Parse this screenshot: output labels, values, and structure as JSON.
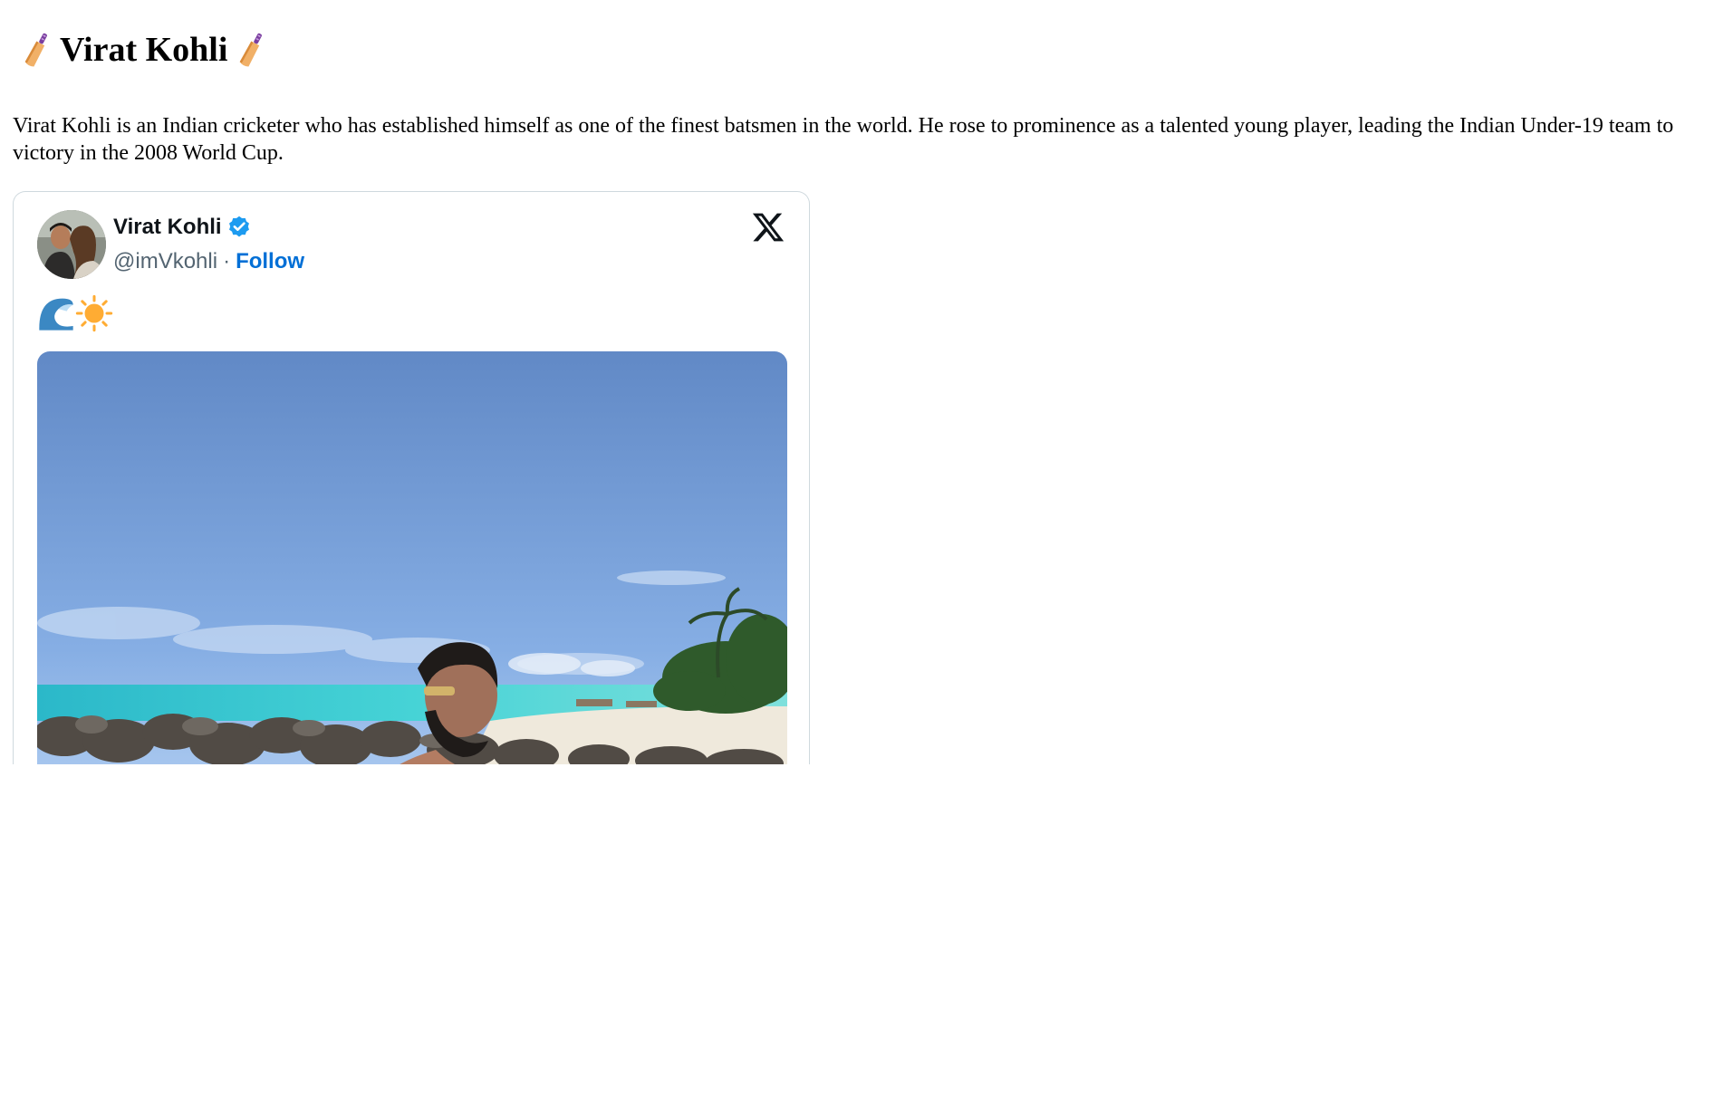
{
  "page": {
    "heading": {
      "title": "Virat Kohli",
      "left_icon": "cricket-bat-icon",
      "right_icon": "cricket-bat-icon"
    },
    "intro": "Virat Kohli is an Indian cricketer who has established himself as one of the finest batsmen in the world. He rose to prominence as a talented young player, leading the Indian Under-19 team to victory in the 2008 World Cup."
  },
  "tweet": {
    "author": {
      "name": "Virat Kohli",
      "handle": "@imVkohli",
      "verified_icon": "verified-badge-icon",
      "avatar_icon": "profile-photo"
    },
    "separator": "·",
    "follow_label": "Follow",
    "platform_icon": "x-logo-icon",
    "text_emojis": [
      "water-wave-icon",
      "sun-icon"
    ],
    "media": "beach-photo",
    "colors": {
      "name": "#0f1419",
      "handle": "#536471",
      "follow": "#006fd6",
      "verified": "#1d9bf0",
      "border": "#cfd9de"
    }
  }
}
